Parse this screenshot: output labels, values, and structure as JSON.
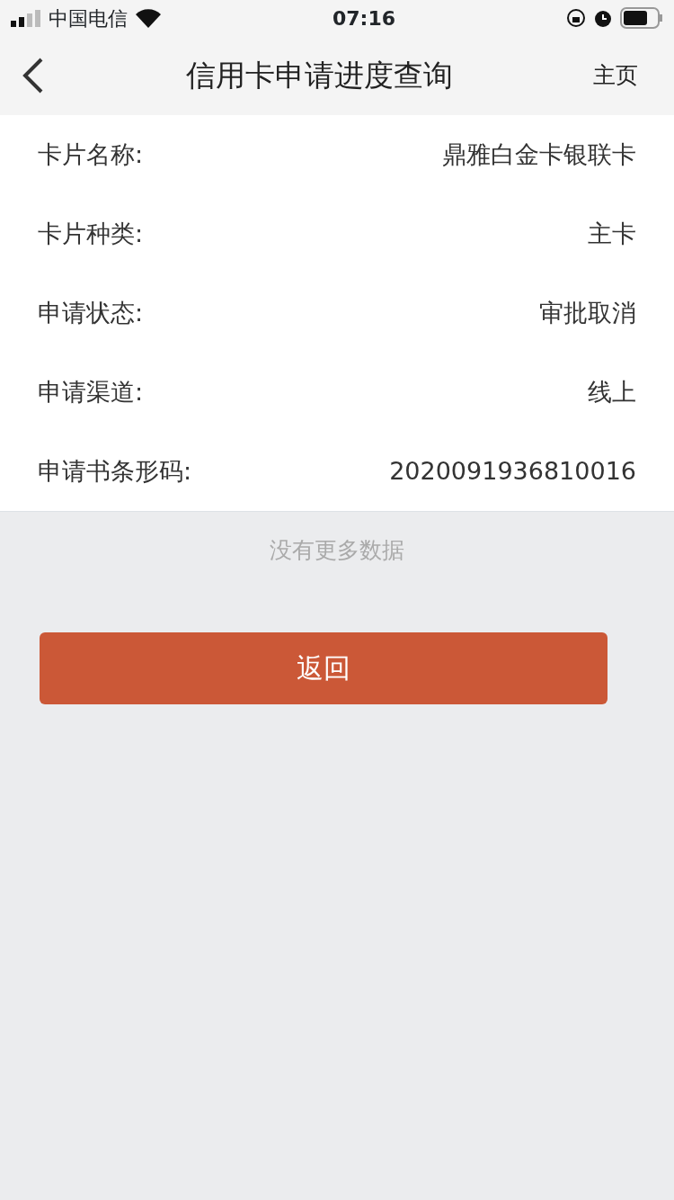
{
  "status_bar": {
    "carrier": "中国电信",
    "time": "07:16"
  },
  "nav": {
    "title": "信用卡申请进度查询",
    "right": "主页"
  },
  "fields": [
    {
      "label": "卡片名称:",
      "value": "鼎雅白金卡银联卡"
    },
    {
      "label": "卡片种类:",
      "value": "主卡"
    },
    {
      "label": "申请状态:",
      "value": "审批取消"
    },
    {
      "label": "申请渠道:",
      "value": "线上"
    },
    {
      "label": "申请书条形码:",
      "value": "2020091936810016"
    }
  ],
  "no_more": "没有更多数据",
  "back_button": "返回"
}
